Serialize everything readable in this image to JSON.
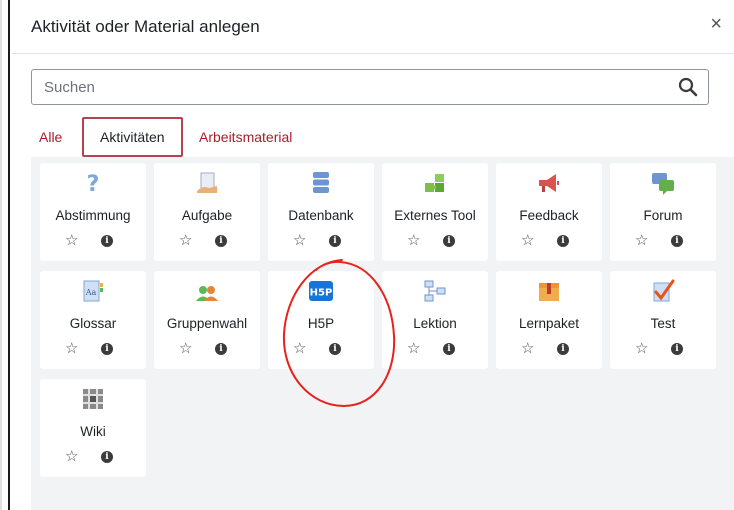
{
  "dialog": {
    "title": "Aktivität oder Material anlegen",
    "close_symbol": "×"
  },
  "search": {
    "placeholder": "Suchen",
    "icon": "search-icon"
  },
  "tabs": [
    {
      "label": "Alle",
      "active": false
    },
    {
      "label": "Aktivitäten",
      "active": true
    },
    {
      "label": "Arbeitsmaterial",
      "active": false
    }
  ],
  "tiles": [
    {
      "label": "Abstimmung",
      "icon": "question-icon"
    },
    {
      "label": "Aufgabe",
      "icon": "assignment-icon"
    },
    {
      "label": "Datenbank",
      "icon": "database-icon"
    },
    {
      "label": "Externes Tool",
      "icon": "puzzle-icon"
    },
    {
      "label": "Feedback",
      "icon": "megaphone-icon"
    },
    {
      "label": "Forum",
      "icon": "chat-icon"
    },
    {
      "label": "Glossar",
      "icon": "glossary-icon"
    },
    {
      "label": "Gruppenwahl",
      "icon": "group-icon"
    },
    {
      "label": "H5P",
      "icon": "h5p-icon"
    },
    {
      "label": "Lektion",
      "icon": "flowchart-icon"
    },
    {
      "label": "Lernpaket",
      "icon": "package-icon"
    },
    {
      "label": "Test",
      "icon": "checkmark-icon"
    },
    {
      "label": "Wiki",
      "icon": "wiki-icon"
    }
  ],
  "tile_actions": {
    "star_symbol": "☆",
    "info_symbol": "i"
  },
  "colors": {
    "link": "#a81d2a",
    "active_tab_border": "#b3434f",
    "annotation": "#e8221b",
    "grid_background": "#f2f3f5"
  }
}
